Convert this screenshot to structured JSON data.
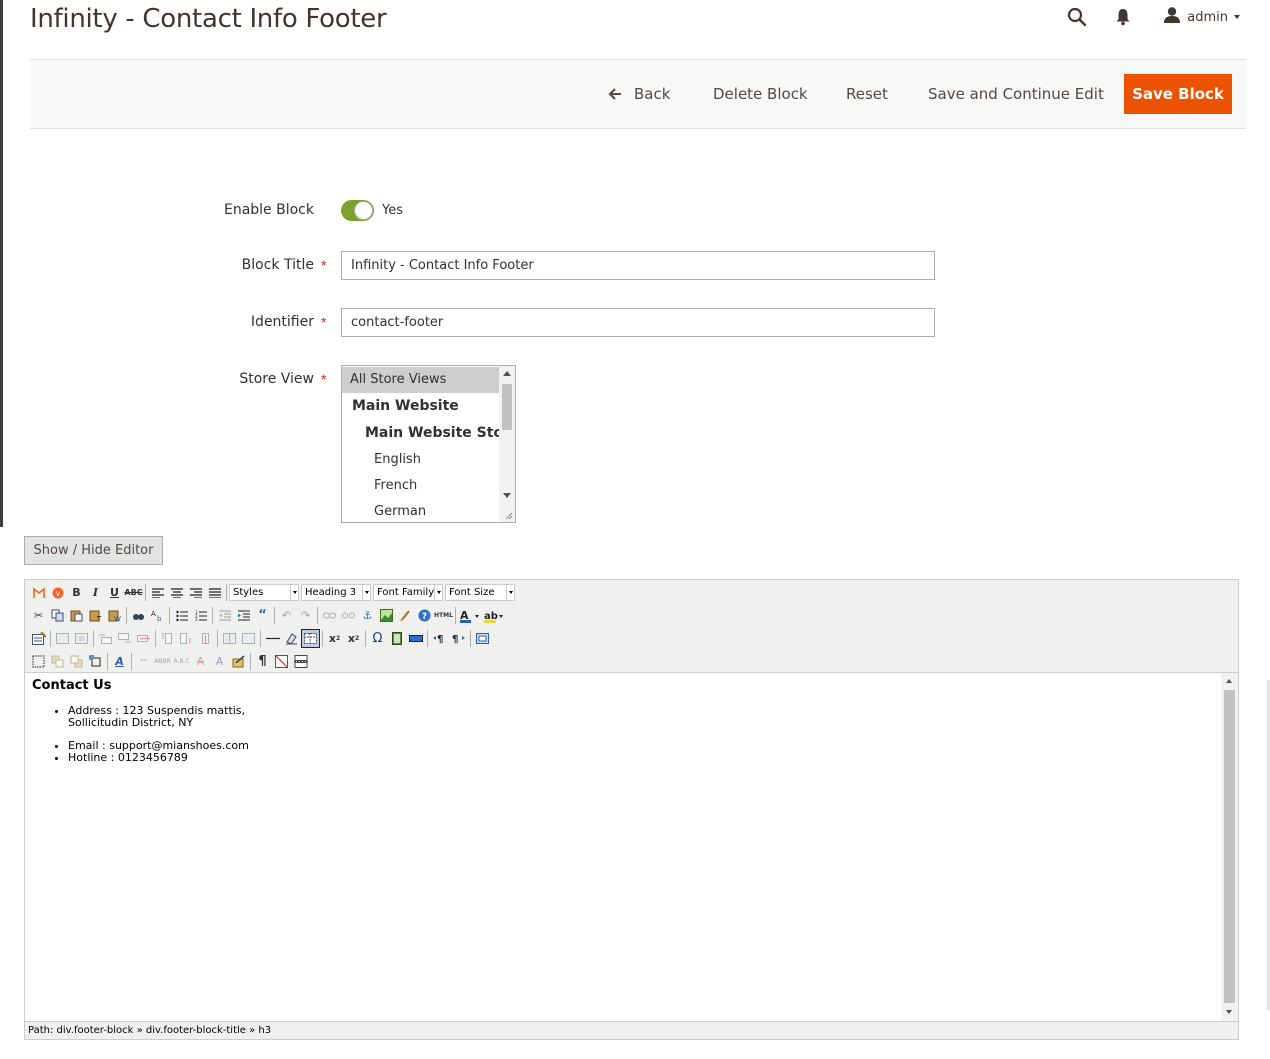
{
  "page": {
    "title": "Infinity - Contact Info Footer"
  },
  "header": {
    "admin_label": "admin"
  },
  "actions": {
    "back": "Back",
    "delete": "Delete Block",
    "reset": "Reset",
    "save_continue": "Save and Continue Edit",
    "save": "Save Block"
  },
  "form": {
    "enable_block": {
      "label": "Enable Block",
      "value": "Yes",
      "enabled": true
    },
    "block_title": {
      "label": "Block Title",
      "value": "Infinity - Contact Info Footer"
    },
    "identifier": {
      "label": "Identifier",
      "value": "contact-footer"
    },
    "store_view": {
      "label": "Store View",
      "options": [
        "All Store Views",
        "Main Website",
        "Main Website Store",
        "English",
        "French",
        "German"
      ],
      "selected": "All Store Views"
    },
    "required_mark": "*"
  },
  "editor": {
    "toggle_label": "Show / Hide Editor",
    "toolbar": {
      "styles": "Styles",
      "format": "Heading 3",
      "font_family": "Font Family",
      "font_size": "Font Size"
    },
    "content": {
      "heading": "Contact Us",
      "address_line1": "Address : 123 Suspendis mattis,",
      "address_line2": "Sollicitudin District, NY",
      "email": "Email : support@mianshoes.com",
      "hotline": "Hotline : 0123456789"
    },
    "path": "Path: div.footer-block » div.footer-block-title » h3"
  },
  "colors": {
    "accent": "#eb5202",
    "toggle_on": "#79a22e",
    "required": "#e22626"
  }
}
